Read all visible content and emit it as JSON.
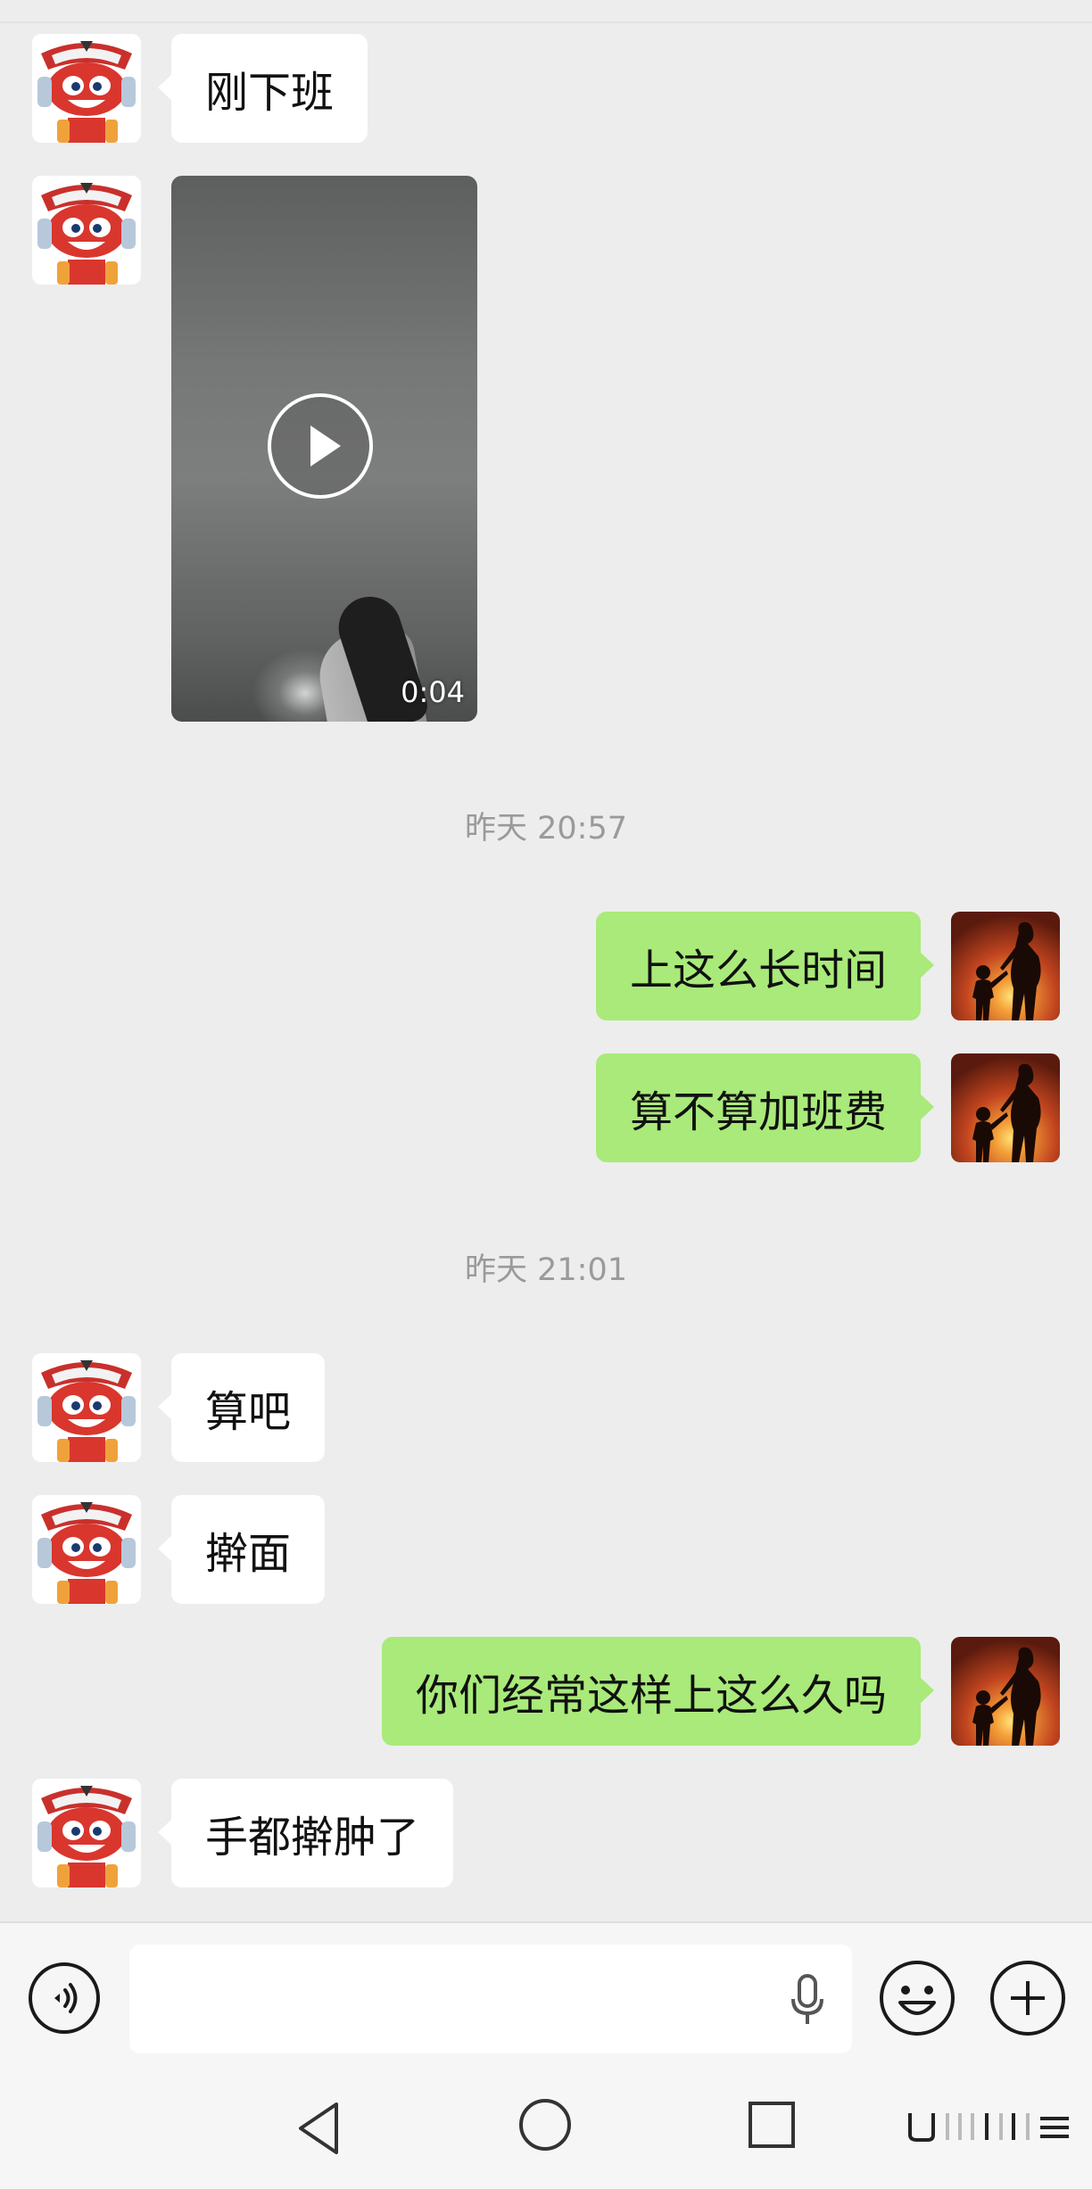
{
  "chat": {
    "messages": [
      {
        "id": "m1",
        "direction": "incoming",
        "text": "刚下班"
      },
      {
        "id": "m2",
        "direction": "incoming",
        "type": "video",
        "duration": "0:04"
      },
      {
        "id": "t1",
        "type": "timestamp",
        "text": "昨天 20:57"
      },
      {
        "id": "m3",
        "direction": "outgoing",
        "text": "上这么长时间"
      },
      {
        "id": "m4",
        "direction": "outgoing",
        "text": "算不算加班费"
      },
      {
        "id": "t2",
        "type": "timestamp",
        "text": "昨天 21:01"
      },
      {
        "id": "m5",
        "direction": "incoming",
        "text": "算吧"
      },
      {
        "id": "m6",
        "direction": "incoming",
        "text": "擀面"
      },
      {
        "id": "m7",
        "direction": "outgoing",
        "text": "你们经常这样上这么久吗"
      },
      {
        "id": "m8",
        "direction": "incoming",
        "text": "手都擀肿了"
      }
    ]
  },
  "input_bar": {
    "voice_toggle_icon": "voice-wave-icon",
    "text_value": "",
    "mic_icon": "microphone-icon",
    "emoji_icon": "smiley-face-icon",
    "more_icon": "plus-circle-icon"
  },
  "nav_bar": {
    "back_icon": "triangle-back-icon",
    "home_icon": "circle-home-icon",
    "recents_icon": "square-recents-icon",
    "menu_icon": "menu-lines-icon"
  },
  "colors": {
    "background": "#ededed",
    "incoming_bubble": "#ffffff",
    "outgoing_bubble": "#a9ea7a",
    "timestamp_text": "#9a9a9a"
  }
}
